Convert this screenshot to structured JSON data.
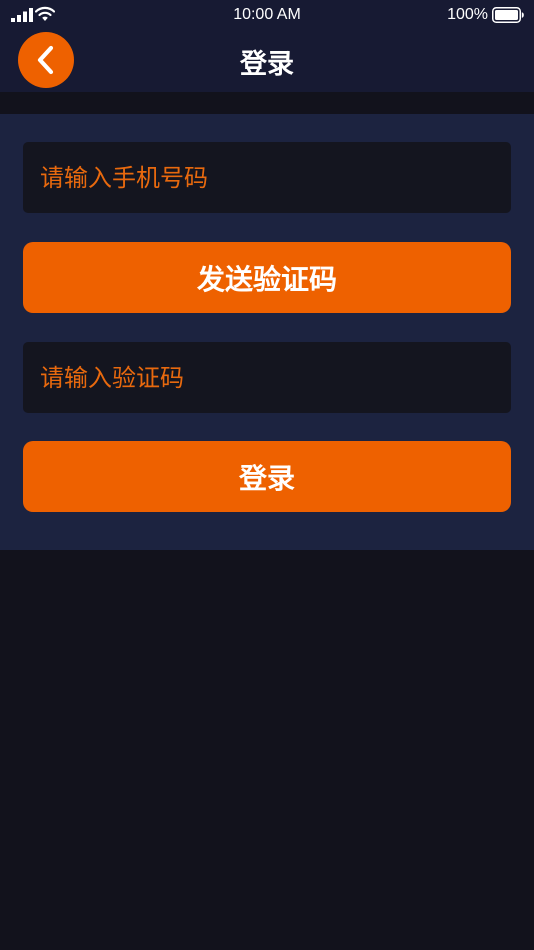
{
  "status_bar": {
    "time": "10:00 AM",
    "battery_percent": "100%",
    "icons": [
      "signal-icon",
      "wifi-icon",
      "battery-icon"
    ]
  },
  "nav": {
    "title": "登录",
    "back_icon": "chevron-left-icon"
  },
  "form": {
    "phone_placeholder": "请输入手机号码",
    "send_code_label": "发送验证码",
    "code_placeholder": "请输入验证码",
    "login_label": "登录"
  },
  "colors": {
    "accent": "#ee6100",
    "nav_background": "#171a33",
    "card_background": "#1c2340",
    "input_background": "#14151f",
    "page_background": "#12121c"
  }
}
